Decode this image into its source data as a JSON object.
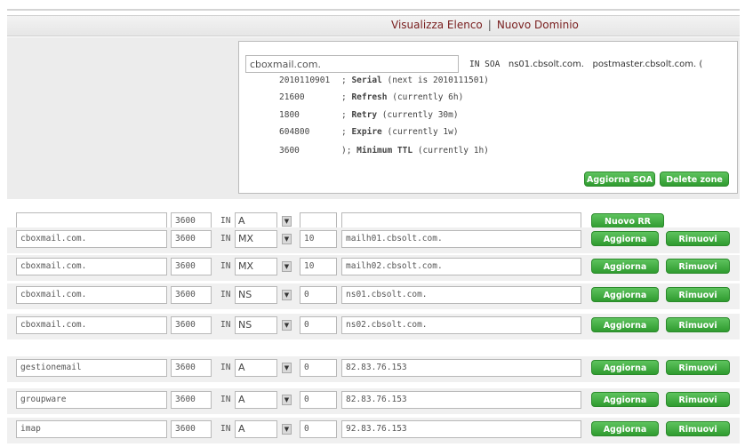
{
  "nav": {
    "view_list": "Visualizza Elenco",
    "separator": "|",
    "new_domain": "Nuovo Dominio"
  },
  "soa": {
    "domain": "cboxmail.com.",
    "in_soa": "IN SOA",
    "primary_ns": "ns01.cbsolt.com.",
    "admin": "postmaster.cbsolt.com. (",
    "lines": [
      {
        "value": "2010110901",
        "comment_prefix": "; ",
        "name": "Serial",
        "comment": " (next is 2010111501)"
      },
      {
        "value": "21600",
        "comment_prefix": "; ",
        "name": "Refresh",
        "comment": " (currently 6h)"
      },
      {
        "value": "1800",
        "comment_prefix": "; ",
        "name": "Retry",
        "comment": " (currently 30m)"
      },
      {
        "value": "604800",
        "comment_prefix": "; ",
        "name": "Expire",
        "comment": " (currently 1w)"
      },
      {
        "value": "3600",
        "comment_prefix": "); ",
        "name": "Minimum TTL",
        "comment": " (currently 1h)"
      }
    ],
    "update_button": "Aggiorna SOA",
    "delete_button": "Delete zone"
  },
  "new_record": {
    "name": "",
    "ttl": "3600",
    "class": "IN",
    "type": "A",
    "priority": "",
    "data": "",
    "button": "Nuovo RR"
  },
  "records": [
    {
      "name": "cboxmail.com.",
      "ttl": "3600",
      "class": "IN",
      "type": "MX",
      "priority": "10",
      "data": "mailh01.cbsolt.com."
    },
    {
      "name": "cboxmail.com.",
      "ttl": "3600",
      "class": "IN",
      "type": "MX",
      "priority": "10",
      "data": "mailh02.cbsolt.com."
    },
    {
      "name": "cboxmail.com.",
      "ttl": "3600",
      "class": "IN",
      "type": "NS",
      "priority": "0",
      "data": "ns01.cbsolt.com."
    },
    {
      "name": "cboxmail.com.",
      "ttl": "3600",
      "class": "IN",
      "type": "NS",
      "priority": "0",
      "data": "ns02.cbsolt.com."
    },
    {
      "name": "gestionemail",
      "ttl": "3600",
      "class": "IN",
      "type": "A",
      "priority": "0",
      "data": "82.83.76.153"
    },
    {
      "name": "groupware",
      "ttl": "3600",
      "class": "IN",
      "type": "A",
      "priority": "0",
      "data": "82.83.76.153"
    },
    {
      "name": "imap",
      "ttl": "3600",
      "class": "IN",
      "type": "A",
      "priority": "0",
      "data": "92.83.76.153"
    }
  ],
  "row_buttons": {
    "update": "Aggiorna",
    "remove": "Rimuovi"
  },
  "colors": {
    "button_green": "#3aa83a",
    "nav_link": "#7a2020"
  }
}
